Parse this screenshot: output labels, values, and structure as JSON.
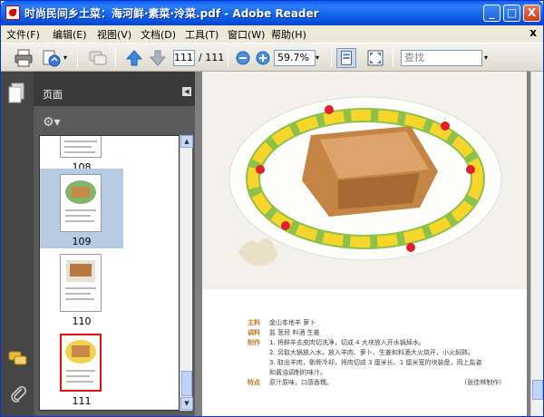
{
  "window": {
    "title": "时尚民间乡土菜：海河鲜·素菜·泠菜.pdf - Adobe Reader",
    "minimize": "_",
    "maximize": "□",
    "close": "X"
  },
  "menu": {
    "items": [
      "文件(F)",
      "编辑(E)",
      "视图(V)",
      "文档(D)",
      "工具(T)",
      "窗口(W)",
      "帮助(H)"
    ],
    "close": "x"
  },
  "toolbar": {
    "page_current": "111",
    "page_total": "/ 111",
    "zoom": "59.7%",
    "search_placeholder": "查找"
  },
  "panel": {
    "title": "页面",
    "collapse": "◀",
    "options": "⚙▾"
  },
  "thumbnails": [
    {
      "label": "108"
    },
    {
      "label": "109",
      "selected": true
    },
    {
      "label": "110"
    },
    {
      "label": "111"
    }
  ],
  "recipe": {
    "rows": [
      {
        "label": "主料",
        "text": "金山本地羊  萝卜"
      },
      {
        "label": "调料",
        "text": "盐  葱段  料酒  生姜"
      },
      {
        "label": "制作",
        "text": "1. 将鲜羊去皮肉切洗净，切成 4 大块放入开水锅焯水。"
      },
      {
        "label": "",
        "text": "2. 另取大锅放入水，放入羊肉、萝卜、生姜和料酒大火烧开，小火焖熟。"
      },
      {
        "label": "",
        "text": "3. 取出羊肉，剔骨冷却，将肉切成 3 厘米长、1 厘米宽的块装盘，用上盐姿"
      },
      {
        "label": "",
        "text": "和酱油调制的味汁。"
      },
      {
        "label": "特点",
        "text": "原汁原味，口感香糯。"
      }
    ],
    "author": "(张佳林制作)"
  },
  "colors": {
    "titlebar": "#0a5df0",
    "panel_bg": "#5a5a5a",
    "selected_thumb": "#b7cce2"
  }
}
